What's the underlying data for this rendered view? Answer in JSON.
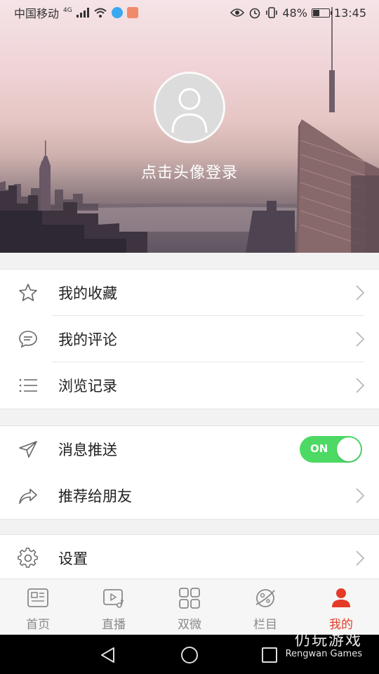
{
  "status_bar": {
    "carrier": "中国移动",
    "network": "4G",
    "battery_percent": "48%",
    "battery_level": 0.48,
    "time": "13:45"
  },
  "header": {
    "login_prompt": "点击头像登录"
  },
  "menu_group_1": [
    {
      "label": "我的收藏",
      "icon": "star-icon"
    },
    {
      "label": "我的评论",
      "icon": "comment-icon"
    },
    {
      "label": "浏览记录",
      "icon": "list-icon"
    }
  ],
  "menu_group_2": [
    {
      "label": "消息推送",
      "icon": "send-icon",
      "toggle": "ON"
    },
    {
      "label": "推荐给朋友",
      "icon": "share-icon"
    }
  ],
  "menu_group_3": [
    {
      "label": "设置",
      "icon": "gear-icon"
    }
  ],
  "tabbar": [
    {
      "label": "首页",
      "icon": "news-icon",
      "active": false
    },
    {
      "label": "直播",
      "icon": "live-video-icon",
      "active": false
    },
    {
      "label": "双微",
      "icon": "grid-icon",
      "active": false
    },
    {
      "label": "栏目",
      "icon": "planet-icon",
      "active": false
    },
    {
      "label": "我的",
      "icon": "user-icon",
      "active": true
    }
  ],
  "watermark": {
    "main": "仍玩游戏",
    "sub": "Rengwan Games"
  },
  "colors": {
    "accent_red": "#e53a27",
    "toggle_green": "#4cd964"
  }
}
